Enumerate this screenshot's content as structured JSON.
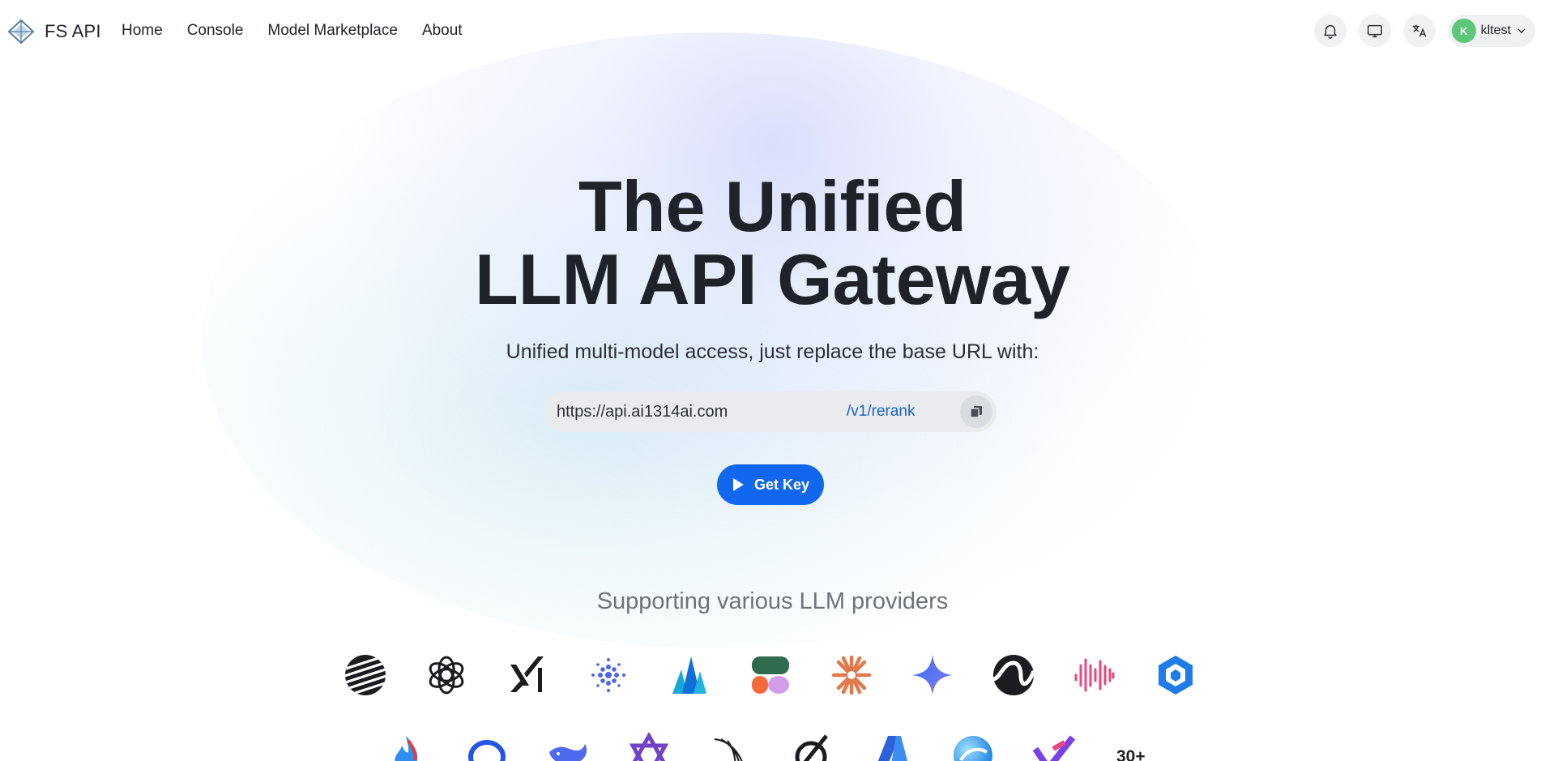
{
  "brand": {
    "name": "FS API",
    "logo_icon": "diamond-logo-icon"
  },
  "nav": {
    "links": [
      {
        "label": "Home"
      },
      {
        "label": "Console"
      },
      {
        "label": "Model Marketplace"
      },
      {
        "label": "About"
      }
    ],
    "right_icons": [
      "bell-icon",
      "monitor-icon",
      "translate-icon"
    ],
    "user": {
      "avatar_letter": "K",
      "name": "kltest",
      "avatar_color": "#5dc878"
    }
  },
  "hero": {
    "title_line1": "The Unified",
    "title_line2": "LLM API Gateway",
    "subtitle": "Unified multi-model access, just replace the base URL with:",
    "base_url": "https://api.ai1314ai.com",
    "endpoint_path": "/v1/rerank",
    "cta_label": "Get Key",
    "accent_color": "#1167f0"
  },
  "providers": {
    "heading": "Supporting various LLM providers",
    "row1": [
      "striped-sphere-logo",
      "openai-logo",
      "xai-logo",
      "dotted-circle-logo",
      "triangle-peaks-logo",
      "figma-shapes-logo",
      "claude-burst-logo",
      "gemini-star-logo",
      "wave-s-logo",
      "audio-wave-logo",
      "hex-cube-logo"
    ],
    "row2": [
      "flame-logo",
      "ring-logo",
      "whale-logo",
      "star-of-david-logo",
      "feather-logo",
      "slash-circle-logo",
      "azure-logo",
      "blue-orb-logo",
      "purple-check-logo"
    ],
    "more_count": "30+"
  }
}
